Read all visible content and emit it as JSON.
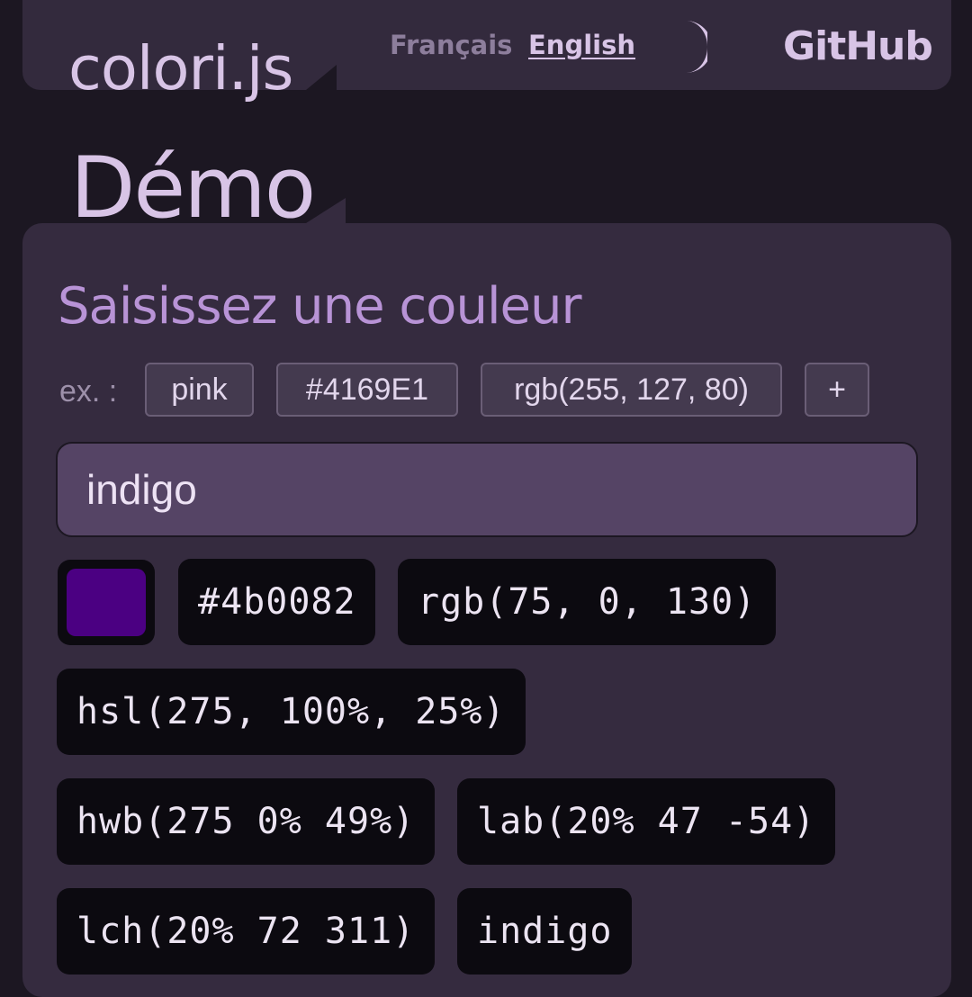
{
  "header": {
    "site_title": "colori.js",
    "lang_fr": "Français",
    "lang_en": "English",
    "github": "GitHub"
  },
  "section_title": "Démo",
  "demo": {
    "heading": "Saisissez une couleur",
    "examples_label": "ex. :",
    "examples": [
      "pink",
      "#4169E1",
      "rgb(255, 127, 80)",
      "+"
    ],
    "input_value": "indigo",
    "swatch_color": "#4b0082",
    "outputs": [
      "#4b0082",
      "rgb(75, 0, 130)",
      "hsl(275, 100%, 25%)",
      "hwb(275 0% 49%)",
      "lab(20% 47 -54)",
      "lch(20% 72 311)",
      "indigo"
    ]
  },
  "colors": {
    "accent": "#b893d6",
    "text": "#d8c4e6",
    "background": "#1c1722",
    "card": "#352b3f"
  }
}
